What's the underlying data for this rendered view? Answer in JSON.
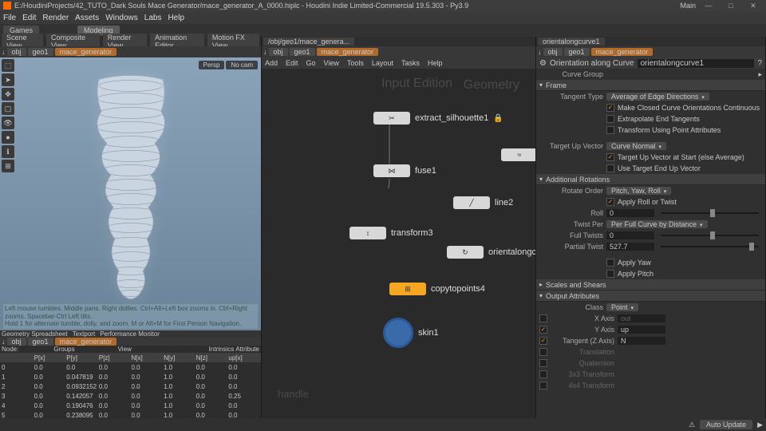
{
  "window": {
    "title": "E:/HoudiniProjects/42_TUTO_Dark Souls Mace Generator/mace_generator_A_0000.hiplc - Houdini Indie Limited-Commercial 19.5.303 - Py3.9",
    "main_label": "Main"
  },
  "menu": [
    "File",
    "Edit",
    "Render",
    "Assets",
    "Windows",
    "Labs",
    "Help"
  ],
  "shelf": {
    "tabs": [
      "Games",
      "Modeling"
    ],
    "active": 1
  },
  "path": {
    "obj": "obj",
    "geo": "geo1",
    "sop": "mace_generator"
  },
  "scene_tabs": [
    "Scene View",
    "Composite View",
    "Render View",
    "Animation Editor",
    "Motion FX View"
  ],
  "vp": {
    "persp": "Persp",
    "nocam": "No cam",
    "help1": "Left mouse tumbles. Middle pans. Right dollies. Ctrl+Alt+Left box zooms in. Ctrl+Right zooms. Spacebar-Ctrl Left tilts.",
    "help2": "Hold 1 for alternate tumble, dolly, and zoom.   M or Alt+M for First Person Navigation."
  },
  "geom_label": "Geometry",
  "net_menu": [
    "Add",
    "Edit",
    "Go",
    "View",
    "Tools",
    "Layout",
    "Tasks",
    "Help"
  ],
  "net_tab": "/obj/geo1/mace_genera...",
  "nodes": {
    "extract": "extract_silhouette1",
    "fuse": "fuse1",
    "line": "line2",
    "transform": "transform3",
    "orient": "orientalongcu",
    "copy": "copytopoints4",
    "skin": "skin1",
    "handle": "handle",
    "edition": "Input Edition"
  },
  "parm": {
    "header": "Orientation along Curve",
    "sel": "orientalongcurve1",
    "curve_group": "Curve Group",
    "frame": "Frame",
    "tangent_type_lbl": "Tangent Type",
    "tangent_type_val": "Average of Edge Directions",
    "c1": "Make Closed Curve Orientations Continuous",
    "c2": "Extrapolate End Tangents",
    "c3": "Transform Using Point Attributes",
    "upvec_lbl": "Target Up Vector",
    "upvec_val": "Curve Normal",
    "c4": "Target Up Vector at Start (else Average)",
    "c5": "Use Target End Up Vector",
    "addrot": "Additional Rotations",
    "rotorder_lbl": "Rotate Order",
    "rotorder_val": "Pitch, Yaw, Roll",
    "c6": "Apply Roll or Twist",
    "roll_lbl": "Roll",
    "roll_val": "0",
    "twistper_lbl": "Twist Per",
    "twistper_val": "Per Full Curve by Distance",
    "fulltwists_lbl": "Full Twists",
    "fulltwists_val": "0",
    "partial_lbl": "Partial Twist",
    "partial_val": "527.7",
    "c7": "Apply Yaw",
    "c8": "Apply Pitch",
    "scales": "Scales and Shears",
    "outattr": "Output Attributes",
    "class_lbl": "Class",
    "class_val": "Point",
    "xaxis_lbl": "X Axis",
    "xaxis_val": "out",
    "yaxis_lbl": "Y Axis",
    "yaxis_val": "up",
    "tangentz_lbl": "Tangent (Z Axis)",
    "tangentz_val": "N",
    "trans_lbl": "Translation",
    "quat_lbl": "Quaternion",
    "xform33_lbl": "3x3 Transform",
    "xform44_lbl": "4x4 Transform"
  },
  "ss": {
    "tabs": [
      "Geometry Spreadsheet",
      "Textport",
      "Performance Monitor"
    ],
    "node_lbl": "Node:",
    "view_lbl": "View",
    "intrinsics": "Intrinsics",
    "attr": "Attribute",
    "groups": "Groups",
    "cols": [
      "",
      "P[x]",
      "P[y]",
      "P[z]",
      "N[x]",
      "N[y]",
      "N[z]",
      "up[x]"
    ],
    "rows": [
      [
        "0",
        "0.0",
        "0.0",
        "0.0",
        "0.0",
        "1.0",
        "0.0",
        "0.0"
      ],
      [
        "1",
        "0.0",
        "0.047819",
        "0.0",
        "0.0",
        "1.0",
        "0.0",
        "0.0"
      ],
      [
        "2",
        "0.0",
        "0.0932152",
        "0.0",
        "0.0",
        "1.0",
        "0.0",
        "0.0"
      ],
      [
        "3",
        "0.0",
        "0.142057",
        "0.0",
        "0.0",
        "1.0",
        "0.0",
        "0.25"
      ],
      [
        "4",
        "0.0",
        "0.190476",
        "0.0",
        "0.0",
        "1.0",
        "0.0",
        "0.0"
      ],
      [
        "5",
        "0.0",
        "0.238095",
        "0.0",
        "0.0",
        "1.0",
        "0.0",
        "0.0"
      ]
    ]
  },
  "status": {
    "auto": "Auto Update"
  }
}
